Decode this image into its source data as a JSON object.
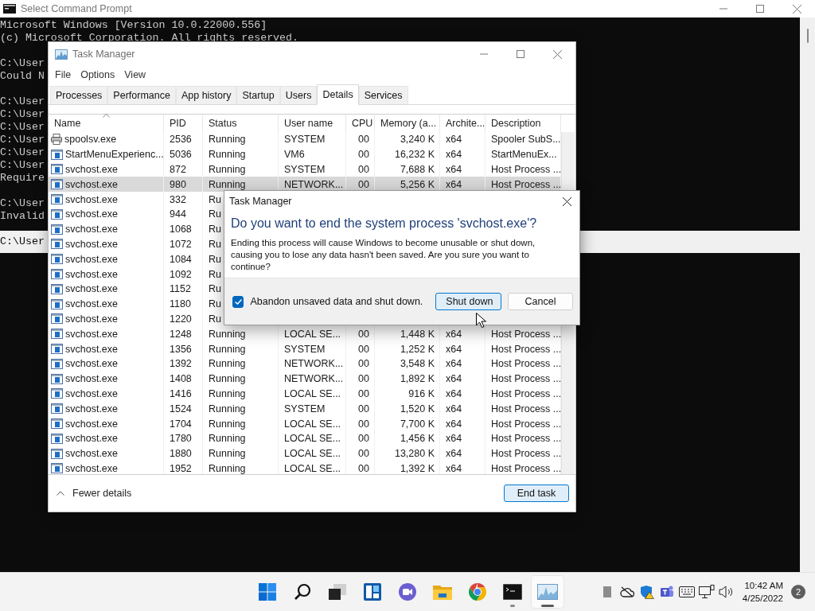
{
  "console": {
    "title": "Select Command Prompt",
    "blocks": [
      [
        {
          "text": "Microsoft Windows [Version 10.0.22000.556]",
          "highlighted": false
        },
        {
          "text": "(c) Microsoft Corporation. All rights reserved.",
          "highlighted": false
        }
      ],
      [
        {
          "text": "C:\\User",
          "highlighted": false
        },
        {
          "text": "Could N",
          "highlighted": false
        }
      ],
      [
        {
          "text": "C:\\User",
          "highlighted": false
        },
        {
          "text": "C:\\User",
          "highlighted": false
        },
        {
          "text": "C:\\User",
          "highlighted": false
        },
        {
          "text": "C:\\User",
          "highlighted": false
        },
        {
          "text": "C:\\User",
          "highlighted": false
        },
        {
          "text": "C:\\User",
          "highlighted": false
        },
        {
          "text": "Require",
          "highlighted": false
        }
      ],
      [
        {
          "text": "C:\\User",
          "highlighted": false
        },
        {
          "text": "Invalid",
          "highlighted": false
        }
      ],
      [
        {
          "text": "C:\\User",
          "highlighted": true
        }
      ]
    ]
  },
  "task_manager": {
    "title": "Task Manager",
    "menu": [
      "File",
      "Options",
      "View"
    ],
    "tabs": [
      {
        "label": "Processes",
        "selected": false
      },
      {
        "label": "Performance",
        "selected": false
      },
      {
        "label": "App history",
        "selected": false
      },
      {
        "label": "Startup",
        "selected": false
      },
      {
        "label": "Users",
        "selected": false
      },
      {
        "label": "Details",
        "selected": true
      },
      {
        "label": "Services",
        "selected": false
      }
    ],
    "columns": [
      {
        "label": "Name",
        "sorted": true
      },
      {
        "label": "PID",
        "sorted": false
      },
      {
        "label": "Status",
        "sorted": false
      },
      {
        "label": "User name",
        "sorted": false
      },
      {
        "label": "CPU",
        "sorted": false
      },
      {
        "label": "Memory (a...",
        "sorted": false
      },
      {
        "label": "Archite...",
        "sorted": false
      },
      {
        "label": "Description",
        "sorted": false
      }
    ],
    "rows": [
      {
        "kind": "printer",
        "name": "spoolsv.exe",
        "pid": "2536",
        "status": "Running",
        "user": "SYSTEM",
        "cpu": "00",
        "memory": "3,240 K",
        "arch": "x64",
        "description": "Spooler SubS...",
        "selected": false
      },
      {
        "kind": "app",
        "name": "StartMenuExperienc...",
        "pid": "5036",
        "status": "Running",
        "user": "VM6",
        "cpu": "00",
        "memory": "16,232 K",
        "arch": "x64",
        "description": "StartMenuEx...",
        "selected": false
      },
      {
        "kind": "app",
        "name": "svchost.exe",
        "pid": "872",
        "status": "Running",
        "user": "SYSTEM",
        "cpu": "00",
        "memory": "7,688 K",
        "arch": "x64",
        "description": "Host Process ...",
        "selected": false
      },
      {
        "kind": "app",
        "name": "svchost.exe",
        "pid": "980",
        "status": "Running",
        "user": "NETWORK...",
        "cpu": "00",
        "memory": "5,256 K",
        "arch": "x64",
        "description": "Host Process ...",
        "selected": true
      },
      {
        "kind": "app",
        "name": "svchost.exe",
        "pid": "332",
        "status": "Ru",
        "selected": false
      },
      {
        "kind": "app",
        "name": "svchost.exe",
        "pid": "944",
        "status": "Ru",
        "selected": false
      },
      {
        "kind": "app",
        "name": "svchost.exe",
        "pid": "1068",
        "status": "Ru",
        "selected": false
      },
      {
        "kind": "app",
        "name": "svchost.exe",
        "pid": "1072",
        "status": "Ru",
        "selected": false
      },
      {
        "kind": "app",
        "name": "svchost.exe",
        "pid": "1084",
        "status": "Ru",
        "selected": false
      },
      {
        "kind": "app",
        "name": "svchost.exe",
        "pid": "1092",
        "status": "Ru",
        "selected": false
      },
      {
        "kind": "app",
        "name": "svchost.exe",
        "pid": "1152",
        "status": "Ru",
        "selected": false
      },
      {
        "kind": "app",
        "name": "svchost.exe",
        "pid": "1180",
        "status": "Ru",
        "selected": false
      },
      {
        "kind": "app",
        "name": "svchost.exe",
        "pid": "1220",
        "status": "Ru",
        "selected": false
      },
      {
        "kind": "app",
        "name": "svchost.exe",
        "pid": "1248",
        "status": "Running",
        "user": "LOCAL SE...",
        "cpu": "00",
        "memory": "1,448 K",
        "arch": "x64",
        "description": "Host Process ...",
        "selected": false
      },
      {
        "kind": "app",
        "name": "svchost.exe",
        "pid": "1356",
        "status": "Running",
        "user": "SYSTEM",
        "cpu": "00",
        "memory": "1,252 K",
        "arch": "x64",
        "description": "Host Process ...",
        "selected": false
      },
      {
        "kind": "app",
        "name": "svchost.exe",
        "pid": "1392",
        "status": "Running",
        "user": "NETWORK...",
        "cpu": "00",
        "memory": "3,548 K",
        "arch": "x64",
        "description": "Host Process ...",
        "selected": false
      },
      {
        "kind": "app",
        "name": "svchost.exe",
        "pid": "1408",
        "status": "Running",
        "user": "NETWORK...",
        "cpu": "00",
        "memory": "1,892 K",
        "arch": "x64",
        "description": "Host Process ...",
        "selected": false
      },
      {
        "kind": "app",
        "name": "svchost.exe",
        "pid": "1416",
        "status": "Running",
        "user": "LOCAL SE...",
        "cpu": "00",
        "memory": "916 K",
        "arch": "x64",
        "description": "Host Process ...",
        "selected": false
      },
      {
        "kind": "app",
        "name": "svchost.exe",
        "pid": "1524",
        "status": "Running",
        "user": "SYSTEM",
        "cpu": "00",
        "memory": "1,520 K",
        "arch": "x64",
        "description": "Host Process ...",
        "selected": false
      },
      {
        "kind": "app",
        "name": "svchost.exe",
        "pid": "1704",
        "status": "Running",
        "user": "LOCAL SE...",
        "cpu": "00",
        "memory": "7,700 K",
        "arch": "x64",
        "description": "Host Process ...",
        "selected": false
      },
      {
        "kind": "app",
        "name": "svchost.exe",
        "pid": "1780",
        "status": "Running",
        "user": "LOCAL SE...",
        "cpu": "00",
        "memory": "1,456 K",
        "arch": "x64",
        "description": "Host Process ...",
        "selected": false
      },
      {
        "kind": "app",
        "name": "svchost.exe",
        "pid": "1880",
        "status": "Running",
        "user": "LOCAL SE...",
        "cpu": "00",
        "memory": "13,280 K",
        "arch": "x64",
        "description": "Host Process ...",
        "selected": false
      },
      {
        "kind": "app",
        "name": "svchost.exe",
        "pid": "1952",
        "status": "Running",
        "user": "LOCAL SE...",
        "cpu": "00",
        "memory": "1,392 K",
        "arch": "x64",
        "description": "Host Process ...",
        "selected": false
      }
    ],
    "footer": {
      "toggle": "Fewer details",
      "button": "End task"
    }
  },
  "dialog": {
    "title": "Task Manager",
    "heading": "Do you want to end the system process 'svchost.exe'?",
    "message": "Ending this process will cause Windows to become unusable or shut down, causing you to lose any data hasn't been saved. Are you sure you want to continue?",
    "checkbox": {
      "label": "Abandon unsaved data and shut down.",
      "checked": true
    },
    "buttons": [
      {
        "label": "Shut down",
        "focused": true
      },
      {
        "label": "Cancel",
        "focused": false
      }
    ]
  },
  "taskbar": {
    "apps": [
      {
        "kind": "start",
        "running": false,
        "active": false
      },
      {
        "kind": "search",
        "running": false,
        "active": false
      },
      {
        "kind": "taskview",
        "running": false,
        "active": false
      },
      {
        "kind": "widgets",
        "running": false,
        "active": false
      },
      {
        "kind": "chat",
        "running": false,
        "active": false
      },
      {
        "kind": "explorer",
        "running": false,
        "active": false
      },
      {
        "kind": "browser",
        "running": false,
        "active": false
      },
      {
        "kind": "terminal",
        "running": true,
        "active": false
      },
      {
        "kind": "taskmanager",
        "running": true,
        "active": true
      }
    ],
    "tray": [
      {
        "kind": "square"
      },
      {
        "kind": "cloud-off"
      },
      {
        "kind": "shield-warning"
      },
      {
        "kind": "teams"
      },
      {
        "kind": "keyboard"
      },
      {
        "kind": "network"
      },
      {
        "kind": "speaker"
      }
    ],
    "time": "10:42 AM",
    "date": "4/25/2022",
    "notifications": "2"
  }
}
